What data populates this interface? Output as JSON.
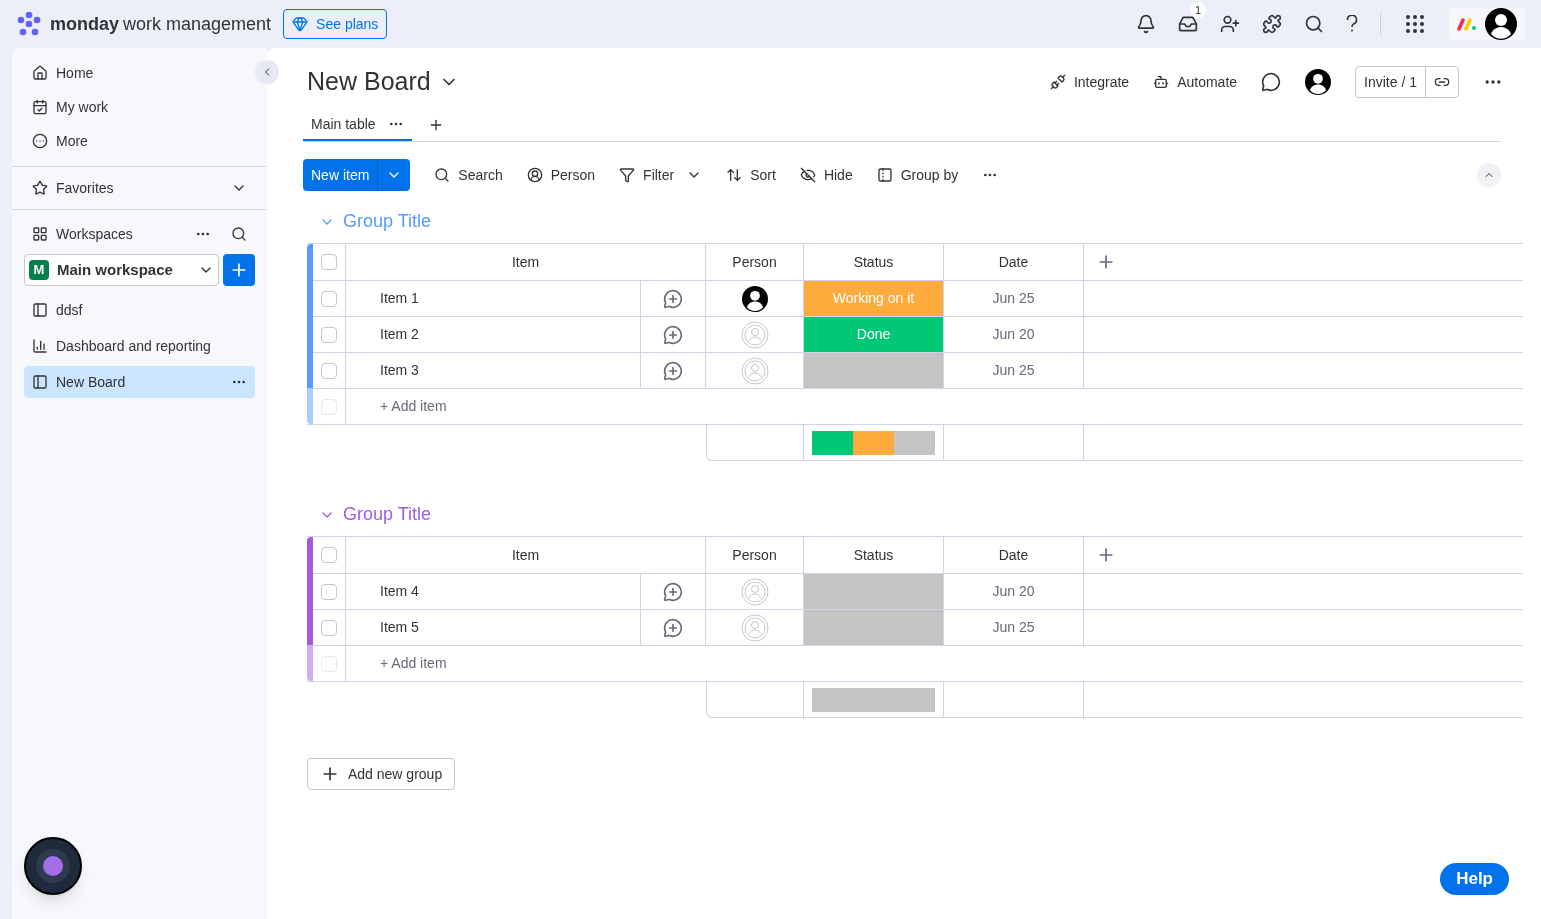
{
  "topbar": {
    "brand": "monday",
    "product": "work management",
    "plans_button": "See plans",
    "inbox_badge": "1"
  },
  "sidebar": {
    "nav": [
      {
        "label": "Home",
        "kind": "home"
      },
      {
        "label": "My work",
        "kind": "mywork"
      },
      {
        "label": "More",
        "kind": "more"
      }
    ],
    "favorites": "Favorites",
    "workspaces": "Workspaces",
    "workspace": {
      "initial": "M",
      "name": "Main workspace"
    },
    "boards": [
      {
        "label": "ddsf",
        "kind": "board",
        "selected": false
      },
      {
        "label": "Dashboard and reporting",
        "kind": "dashboard",
        "selected": false
      },
      {
        "label": "New Board",
        "kind": "board",
        "selected": true
      }
    ]
  },
  "board": {
    "title": "New Board",
    "actions": [
      "Integrate",
      "Automate"
    ],
    "invite": "Invite / 1",
    "views": [
      {
        "label": "Main table",
        "selected": true
      }
    ],
    "toolbar": {
      "new_item": "New item",
      "tools": [
        "Search",
        "Person",
        "Filter",
        "Sort",
        "Hide",
        "Group by"
      ]
    },
    "groups": [
      {
        "title": "Group Title",
        "color": "#579bfc",
        "header_checked": false,
        "add_checked": false,
        "columns": [
          "Item",
          "Person",
          "Status",
          "Date"
        ],
        "rows": [
          {
            "item": "Item 1",
            "checked": false,
            "assigned": true,
            "status": {
              "label": "Working on it",
              "kind": "working",
              "color": "#fdab3d"
            },
            "date": "Jun 25"
          },
          {
            "item": "Item 2",
            "checked": false,
            "assigned": false,
            "status": {
              "label": "Done",
              "kind": "done",
              "color": "#00c875"
            },
            "date": "Jun 20"
          },
          {
            "item": "Item 3",
            "checked": false,
            "assigned": false,
            "status": {
              "kind": "empty",
              "color": "#c4c4c4"
            },
            "date": "Jun 25"
          }
        ],
        "add_item": "+ Add item"
      },
      {
        "title": "Group Title",
        "color": "#a25ddc",
        "header_checked": false,
        "add_checked": false,
        "columns": [
          "Item",
          "Person",
          "Status",
          "Date"
        ],
        "rows": [
          {
            "item": "Item 4",
            "checked": false,
            "assigned": false,
            "status": {
              "kind": "empty",
              "color": "#c4c4c4"
            },
            "date": "Jun 20"
          },
          {
            "item": "Item 5",
            "checked": false,
            "assigned": false,
            "status": {
              "kind": "empty",
              "color": "#c4c4c4"
            },
            "date": "Jun 25"
          }
        ],
        "add_item": "+ Add item"
      }
    ],
    "add_group": "Add new group"
  },
  "help": "Help"
}
